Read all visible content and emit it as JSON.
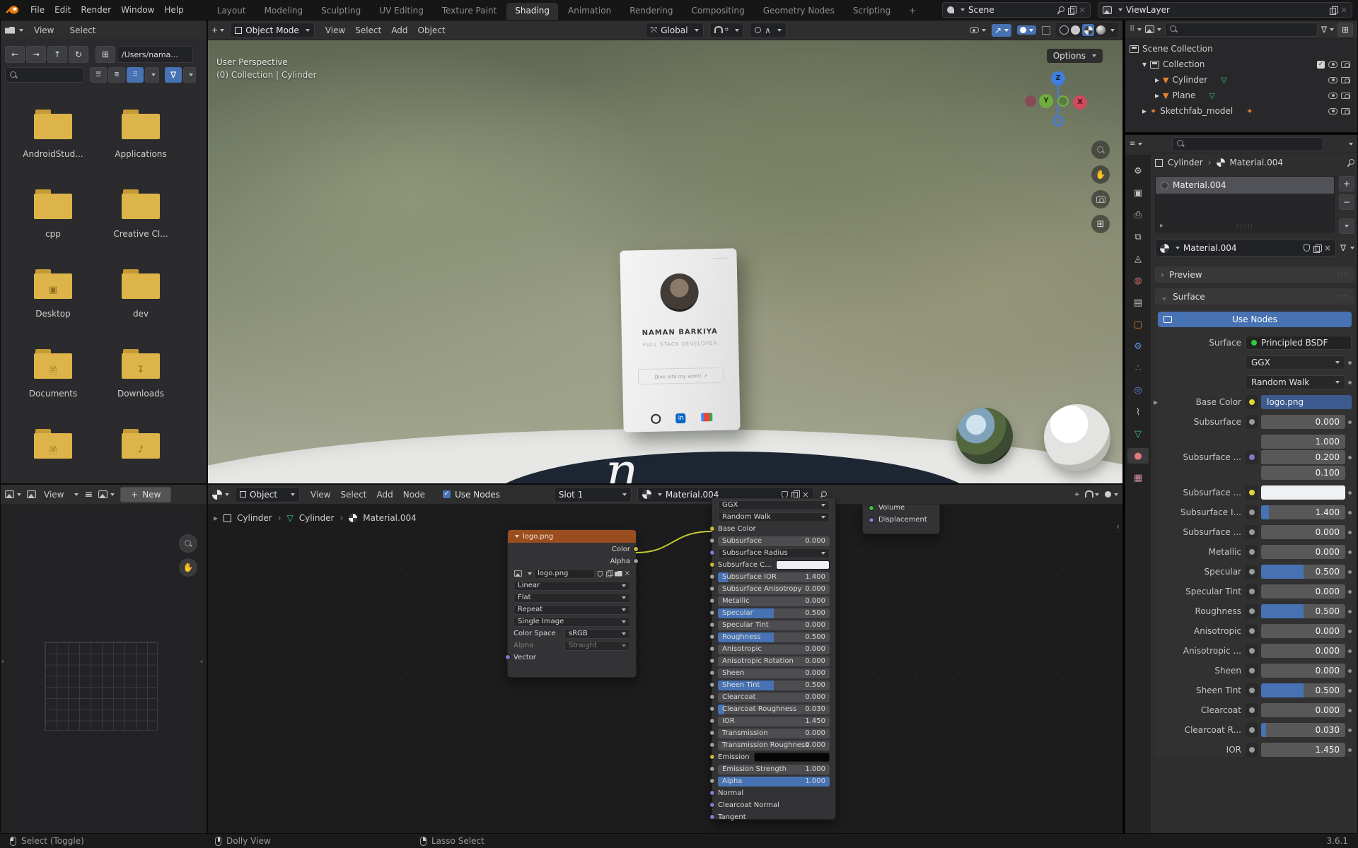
{
  "topbar": {
    "menus": [
      "File",
      "Edit",
      "Render",
      "Window",
      "Help"
    ],
    "workspaces": [
      "Layout",
      "Modeling",
      "Sculpting",
      "UV Editing",
      "Texture Paint",
      "Shading",
      "Animation",
      "Rendering",
      "Compositing",
      "Geometry Nodes",
      "Scripting"
    ],
    "active_workspace": "Shading",
    "add_tab": "+",
    "scene_label": "Scene",
    "viewlayer_label": "ViewLayer"
  },
  "file_browser": {
    "menus": [
      "View",
      "Select"
    ],
    "path": "/Users/nama...",
    "folders": [
      {
        "name": "AndroidStud...",
        "glyph": ""
      },
      {
        "name": "Applications",
        "glyph": ""
      },
      {
        "name": "cpp",
        "glyph": ""
      },
      {
        "name": "Creative Cl...",
        "glyph": ""
      },
      {
        "name": "Desktop",
        "glyph": "image"
      },
      {
        "name": "dev",
        "glyph": ""
      },
      {
        "name": "Documents",
        "glyph": "docs"
      },
      {
        "name": "Downloads",
        "glyph": "download"
      },
      {
        "name": "",
        "glyph": "docs"
      },
      {
        "name": "",
        "glyph": "music"
      }
    ]
  },
  "viewport": {
    "mode": "Object Mode",
    "menus": [
      "View",
      "Select",
      "Add",
      "Object"
    ],
    "orientation": "Global",
    "options": "Options",
    "overlay_line1": "User Perspective",
    "overlay_line2": "(0) Collection | Cylinder",
    "axis_z": "Z",
    "axis_y": "Y",
    "axis_x": "X",
    "card": {
      "name": "NAMAN BARKIYA",
      "role": "FULL STACK DEVELOPER",
      "cta": "Dive into my work! ↗",
      "handle": "⸻"
    },
    "disc_letter": "n"
  },
  "image_editor": {
    "view_menu": "View",
    "new_button": "New",
    "plus": "+"
  },
  "shader_editor": {
    "shader_type": "Object",
    "menus": [
      "View",
      "Select",
      "Add",
      "Node"
    ],
    "use_nodes": "Use Nodes",
    "slot": "Slot 1",
    "material": "Material.004",
    "breadcrumb": [
      "Cylinder",
      "Cylinder",
      "Material.004"
    ],
    "image_node": {
      "title": "logo.png",
      "out_color": "Color",
      "out_alpha": "Alpha",
      "image_field": "logo.png",
      "dropdowns": [
        "Linear",
        "Flat",
        "Repeat",
        "Single Image"
      ],
      "color_space_label": "Color Space",
      "color_space": "sRGB",
      "alpha_label": "Alpha",
      "alpha_value": "Straight",
      "input_label": "Vector"
    },
    "bsdf_node": {
      "dropdown1": "GGX",
      "dropdown2": "Random Walk",
      "rows": [
        {
          "label": "Base Color",
          "type": "socket",
          "socket": "#c9b43a",
          "connected": true
        },
        {
          "label": "Subsurface",
          "type": "slider",
          "value": "0.000",
          "fill": 0,
          "socket": "#9d9d9d"
        },
        {
          "label": "Subsurface Radius",
          "type": "dropdown",
          "socket": "#8277c9"
        },
        {
          "label": "Subsurface C...",
          "type": "swatch",
          "swatch": "#eceef2",
          "socket": "#c9b43a"
        },
        {
          "label": "Subsurface IOR",
          "type": "slider",
          "value": "1.400",
          "fill": 0.09,
          "socket": "#9d9d9d"
        },
        {
          "label": "Subsurface Anisotropy",
          "type": "slider",
          "value": "0.000",
          "fill": 0,
          "socket": "#9d9d9d"
        },
        {
          "label": "Metallic",
          "type": "slider",
          "value": "0.000",
          "fill": 0,
          "socket": "#9d9d9d"
        },
        {
          "label": "Specular",
          "type": "slider",
          "value": "0.500",
          "fill": 0.5,
          "socket": "#9d9d9d"
        },
        {
          "label": "Specular Tint",
          "type": "slider",
          "value": "0.000",
          "fill": 0,
          "socket": "#9d9d9d"
        },
        {
          "label": "Roughness",
          "type": "slider",
          "value": "0.500",
          "fill": 0.5,
          "socket": "#9d9d9d"
        },
        {
          "label": "Anisotropic",
          "type": "slider",
          "value": "0.000",
          "fill": 0,
          "socket": "#9d9d9d"
        },
        {
          "label": "Anisotropic Rotation",
          "type": "slider",
          "value": "0.000",
          "fill": 0,
          "socket": "#9d9d9d"
        },
        {
          "label": "Sheen",
          "type": "slider",
          "value": "0.000",
          "fill": 0,
          "socket": "#9d9d9d"
        },
        {
          "label": "Sheen Tint",
          "type": "slider",
          "value": "0.500",
          "fill": 0.5,
          "socket": "#9d9d9d"
        },
        {
          "label": "Clearcoat",
          "type": "slider",
          "value": "0.000",
          "fill": 0,
          "socket": "#9d9d9d"
        },
        {
          "label": "Clearcoat Roughness",
          "type": "slider",
          "value": "0.030",
          "fill": 0.06,
          "socket": "#9d9d9d"
        },
        {
          "label": "IOR",
          "type": "slider",
          "value": "1.450",
          "fill": 0,
          "socket": "#9d9d9d"
        },
        {
          "label": "Transmission",
          "type": "slider",
          "value": "0.000",
          "fill": 0,
          "socket": "#9d9d9d"
        },
        {
          "label": "Transmission Roughness",
          "type": "slider",
          "value": "0.000",
          "fill": 0,
          "socket": "#9d9d9d"
        },
        {
          "label": "Emission",
          "type": "swatch",
          "swatch": "#050505",
          "socket": "#c9b43a"
        },
        {
          "label": "Emission Strength",
          "type": "slider",
          "value": "1.000",
          "fill": 0,
          "socket": "#9d9d9d"
        },
        {
          "label": "Alpha",
          "type": "slider",
          "value": "1.000",
          "fill": 1,
          "socket": "#9d9d9d"
        },
        {
          "label": "Normal",
          "type": "socket",
          "socket": "#8277c9"
        },
        {
          "label": "Clearcoat Normal",
          "type": "socket",
          "socket": "#8277c9"
        },
        {
          "label": "Tangent",
          "type": "socket",
          "socket": "#8277c9"
        }
      ]
    },
    "output_node": {
      "rows": [
        {
          "label": "Volume",
          "socket": "#3fbf3f"
        },
        {
          "label": "Displacement",
          "socket": "#8277c9"
        }
      ]
    }
  },
  "outliner": {
    "items": [
      {
        "label": "Scene Collection",
        "indent": 0,
        "expand": "",
        "icon": "box",
        "data_icon": "",
        "controls": []
      },
      {
        "label": "Collection",
        "indent": 1,
        "expand": "open",
        "icon": "box",
        "data_icon": "",
        "controls": [
          "check",
          "eye",
          "cam"
        ]
      },
      {
        "label": "Cylinder",
        "indent": 2,
        "expand": "closed",
        "icon": "object",
        "data_icon": "mesh",
        "controls": [
          "eye",
          "cam"
        ]
      },
      {
        "label": "Plane",
        "indent": 2,
        "expand": "closed",
        "icon": "object",
        "data_icon": "mesh",
        "controls": [
          "eye",
          "cam"
        ]
      },
      {
        "label": "Sketchfab_model",
        "indent": 1,
        "expand": "closed",
        "icon": "empty",
        "data_icon": "empty",
        "controls": [
          "eye",
          "cam"
        ]
      }
    ]
  },
  "properties": {
    "tabs": [
      "tool",
      "render",
      "output",
      "viewlayer",
      "scene",
      "world",
      "collection",
      "object",
      "modifiers",
      "particles",
      "physics",
      "constraints",
      "data",
      "material",
      "texture"
    ],
    "active_tab": "material",
    "breadcrumb_object": "Cylinder",
    "breadcrumb_material": "Material.004",
    "slot_item": "Material.004",
    "datablock": "Material.004",
    "preview_label": "Preview",
    "surface_panel_label": "Surface",
    "use_nodes": "Use Nodes",
    "surface_row_label": "Surface",
    "surface_value": "Principled BSDF",
    "distribution": "GGX",
    "sss_method": "Random Walk",
    "base_color_label": "Base Color",
    "base_color_value": "logo.png",
    "rows": [
      {
        "label": "Subsurface",
        "value": "0.000",
        "dot": "#9a9a9a",
        "fill": 0
      },
      {
        "label": "Subsurface ...",
        "values": [
          "1.000",
          "0.200",
          "0.100"
        ],
        "dot": "#8277c9"
      },
      {
        "label": "Subsurface ...",
        "swatch": "#f0f1f4",
        "dot": "#e3d43c"
      },
      {
        "label": "Subsurface I...",
        "value": "1.400",
        "dot": "#9a9a9a",
        "fill": 0.09
      },
      {
        "label": "Subsurface ...",
        "value": "0.000",
        "dot": "#9a9a9a",
        "fill": 0
      },
      {
        "label": "Metallic",
        "value": "0.000",
        "dot": "#9a9a9a",
        "fill": 0
      },
      {
        "label": "Specular",
        "value": "0.500",
        "dot": "#9a9a9a",
        "fill": 0.5
      },
      {
        "label": "Specular Tint",
        "value": "0.000",
        "dot": "#9a9a9a",
        "fill": 0
      },
      {
        "label": "Roughness",
        "value": "0.500",
        "dot": "#9a9a9a",
        "fill": 0.5
      },
      {
        "label": "Anisotropic",
        "value": "0.000",
        "dot": "#9a9a9a",
        "fill": 0
      },
      {
        "label": "Anisotropic ...",
        "value": "0.000",
        "dot": "#9a9a9a",
        "fill": 0
      },
      {
        "label": "Sheen",
        "value": "0.000",
        "dot": "#9a9a9a",
        "fill": 0
      },
      {
        "label": "Sheen Tint",
        "value": "0.500",
        "dot": "#9a9a9a",
        "fill": 0.5
      },
      {
        "label": "Clearcoat",
        "value": "0.000",
        "dot": "#9a9a9a",
        "fill": 0
      },
      {
        "label": "Clearcoat R...",
        "value": "0.030",
        "dot": "#9a9a9a",
        "fill": 0.06
      },
      {
        "label": "IOR",
        "value": "1.450",
        "dot": "#9a9a9a",
        "fill": 0
      }
    ]
  },
  "statusbar": {
    "hints": [
      {
        "label": "Select (Toggle)",
        "btn": "left"
      },
      {
        "label": "Dolly View",
        "btn": "middle"
      },
      {
        "label": "Lasso Select",
        "btn": "right"
      }
    ],
    "version": "3.6.1"
  },
  "colors": {
    "accent": "#4772b3",
    "node_header": "#9a4e1f",
    "folder": "#ddb449",
    "object_orange": "#e8822f",
    "mesh_green": "#39c08a"
  }
}
